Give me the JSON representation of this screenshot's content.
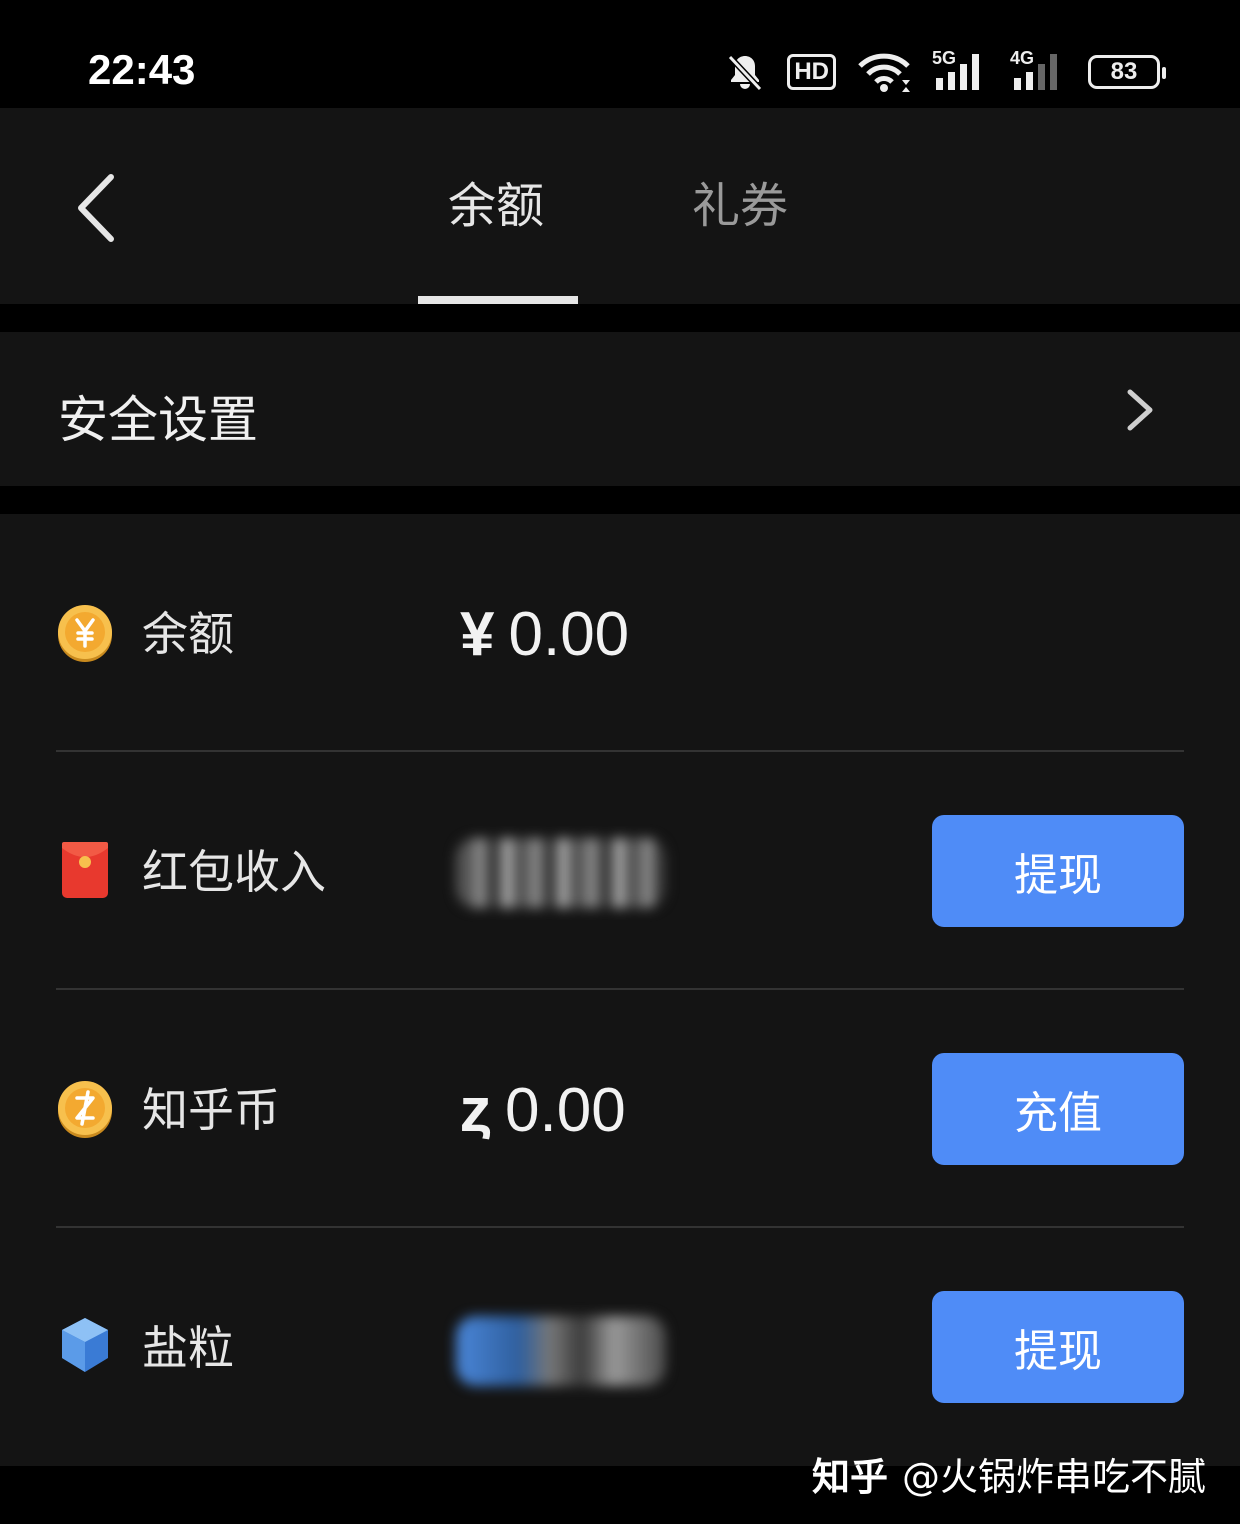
{
  "status_bar": {
    "time": "22:43",
    "hd_label": "HD",
    "net1_label": "5G",
    "net2_label": "4G",
    "battery": "83"
  },
  "nav": {
    "tabs": [
      {
        "label": "余额",
        "active": true
      },
      {
        "label": "礼券",
        "active": false
      }
    ]
  },
  "security": {
    "label": "安全设置"
  },
  "wallet": {
    "rows": [
      {
        "label": "余额",
        "currency": "¥",
        "value": "0.00",
        "icon": "yuan-coin-icon"
      },
      {
        "label": "红包收入",
        "value_hidden": true,
        "action": "提现",
        "icon": "red-envelope-icon"
      },
      {
        "label": "知乎币",
        "currency": "ȥ",
        "value": "0.00",
        "action": "充值",
        "icon": "zhihu-coin-icon"
      },
      {
        "label": "盐粒",
        "value_hidden": true,
        "action": "提现",
        "icon": "salt-crystal-icon"
      }
    ]
  },
  "watermark": {
    "brand": "知乎",
    "handle": "@火锅炸串吃不腻"
  },
  "colors": {
    "accent": "#4f8cf7",
    "panel": "#141414",
    "background": "#000000",
    "coin_gold": "#f5b640",
    "envelope_red": "#e8392e"
  }
}
